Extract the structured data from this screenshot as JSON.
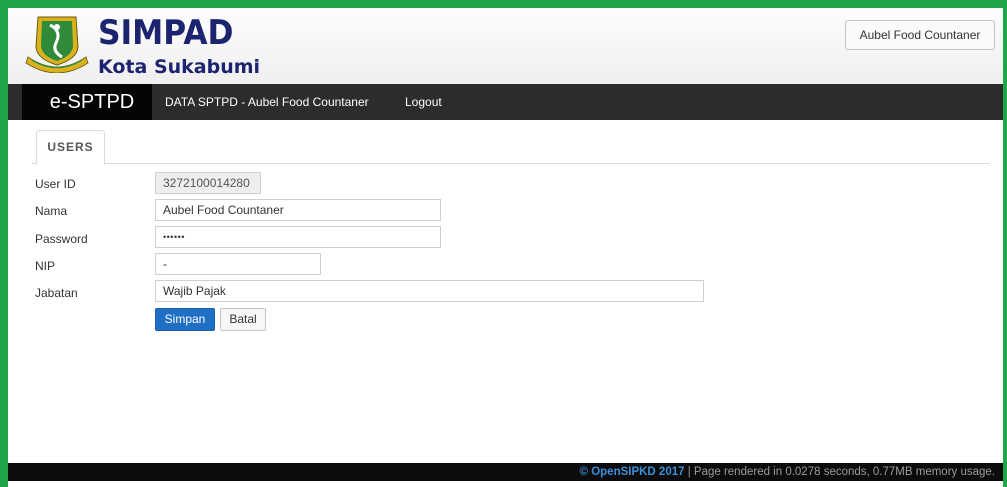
{
  "header": {
    "app_title": "SIMPAD",
    "app_subtitle": "Kota Sukabumi",
    "user_button_label": "Aubel Food Countaner"
  },
  "navbar": {
    "brand": "e-SPTPD",
    "links": [
      {
        "label": "DATA SPTPD - Aubel Food Countaner"
      },
      {
        "label": "Logout"
      }
    ]
  },
  "tabs": [
    {
      "label": "USERS",
      "active": true
    }
  ],
  "form": {
    "fields": [
      {
        "label": "User ID",
        "value": "3272100014280",
        "readonly": true
      },
      {
        "label": "Nama",
        "value": "Aubel Food Countaner"
      },
      {
        "label": "Password",
        "value": "••••••"
      },
      {
        "label": "NIP",
        "value": "-"
      },
      {
        "label": "Jabatan",
        "value": "Wajib Pajak"
      }
    ],
    "save_label": "Simpan",
    "cancel_label": "Batal"
  },
  "footer": {
    "copyright": "© OpenSIPKD 2017",
    "render_info": " | Page rendered in 0.0278 seconds, 0.77MB memory usage."
  },
  "colors": {
    "frame_border": "#1fa64a",
    "navbar": "#2c2c2c",
    "brand_text": "#1c2470",
    "primary_button": "#1f6fc5",
    "footer_link": "#3a8fd8"
  },
  "icons": {
    "logo": "city-crest-emblem"
  }
}
